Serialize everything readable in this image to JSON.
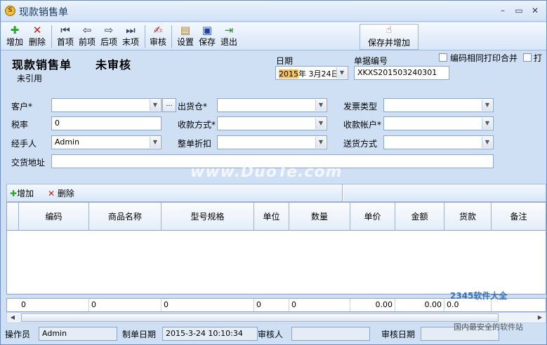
{
  "window": {
    "title": "现款销售单",
    "app_icon": "S"
  },
  "toolbar": {
    "add": "增加",
    "delete": "删除",
    "first": "首项",
    "prev": "前项",
    "next": "后项",
    "last": "末项",
    "audit": "审核",
    "settings": "设置",
    "save": "保存",
    "exit": "退出",
    "save_and_add": "保存并增加"
  },
  "header": {
    "doc_title": "现款销售单",
    "doc_status": "未审核",
    "ref_state": "未引用",
    "date_label": "日期",
    "date_year": "2015",
    "date_rest": "年 3月24日",
    "doc_no_label": "单据编号",
    "doc_no": "XKXS201503240301",
    "merge_print_label": "编码相同打印合并",
    "print_label": "打"
  },
  "form": {
    "customer_label": "客户*",
    "warehouse_label": "出货仓*",
    "invoice_type_label": "发票类型",
    "tax_rate_label": "税率",
    "tax_rate_value": "0",
    "payment_method_label": "收款方式*",
    "account_label": "收款帐户*",
    "handler_label": "经手人",
    "handler_value": "Admin",
    "discount_label": "整单折扣",
    "delivery_label": "送货方式",
    "address_label": "交货地址"
  },
  "detail_toolbar": {
    "add": "增加",
    "delete": "删除"
  },
  "grid": {
    "columns": [
      "编码",
      "商品名称",
      "型号规格",
      "单位",
      "数量",
      "单价",
      "金额",
      "货款",
      "备注"
    ]
  },
  "summary": {
    "c1": "0",
    "c2": "0",
    "c3": "0",
    "c4": "0",
    "c5": "0",
    "c6": "0.00",
    "c7": "0.00",
    "c8": "0.0"
  },
  "statusbar": {
    "operator_label": "操作员",
    "operator_value": "Admin",
    "created_label": "制单日期",
    "created_value": "2015-3-24 10:10:34",
    "auditor_label": "审核人",
    "audit_date_label": "审核日期"
  },
  "watermarks": {
    "main": "www.DuoTe.com",
    "corner": "2345软件大全",
    "corner_sub": "国内最安全的软件站"
  }
}
